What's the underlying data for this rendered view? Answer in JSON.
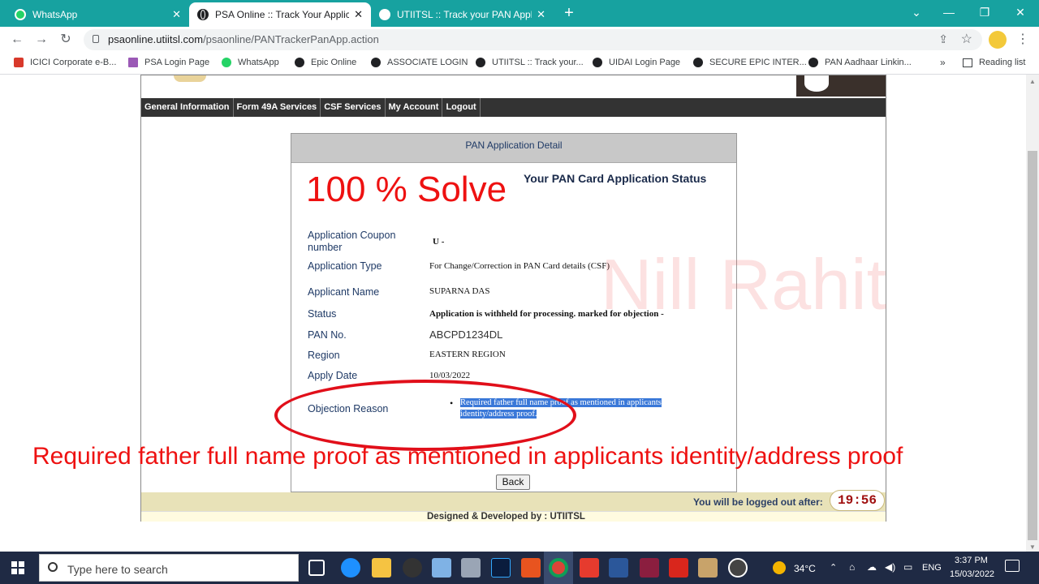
{
  "browser": {
    "tabs": [
      {
        "title": "WhatsApp",
        "icon": "whatsapp-icon",
        "active": false
      },
      {
        "title": "PSA Online :: Track Your Applicati",
        "icon": "globe-icon",
        "active": true
      },
      {
        "title": "UTIITSL :: Track your PAN Applica",
        "icon": "globe-icon",
        "active": false
      }
    ],
    "url_host": "psaonline.utiitsl.com",
    "url_path": "/psaonline/PANTrackerPanApp.action",
    "bookmarks": [
      {
        "label": "ICICI Corporate e-B...",
        "icon": "icici-icon"
      },
      {
        "label": "PSA Login Page",
        "icon": "psa-icon"
      },
      {
        "label": "WhatsApp",
        "icon": "whatsapp-icon"
      },
      {
        "label": "Epic Online",
        "icon": "globe-icon"
      },
      {
        "label": "ASSOCIATE LOGIN",
        "icon": "globe-icon"
      },
      {
        "label": "UTIITSL :: Track your...",
        "icon": "globe-icon"
      },
      {
        "label": "UIDAI Login Page",
        "icon": "globe-icon"
      },
      {
        "label": "SECURE EPIC INTER...",
        "icon": "globe-icon"
      },
      {
        "label": "PAN Aadhaar Linkin...",
        "icon": "globe-icon"
      }
    ],
    "more_bookmarks": "»",
    "reading_list": "Reading list"
  },
  "site": {
    "nav": [
      "General Information",
      "Form 49A Services",
      "CSF Services",
      "My Account",
      "Logout"
    ],
    "panel_title": "PAN Application Detail",
    "status_heading": "Your PAN Card Application Status",
    "fields": [
      {
        "label": "Application Coupon number",
        "value": "U -"
      },
      {
        "label": "Application Type",
        "value": "For Change/Correction in PAN Card details (CSF)"
      },
      {
        "label": "Applicant Name",
        "value": "SUPARNA DAS"
      },
      {
        "label": "Status",
        "value": "Application is withheld for processing. marked for objection -"
      },
      {
        "label": "PAN No.",
        "value": "ABCPD1234DL"
      },
      {
        "label": "Region",
        "value": "EASTERN REGION"
      },
      {
        "label": "Apply Date",
        "value": "10/03/2022"
      }
    ],
    "objection_label": "Objection Reason",
    "objection_reason": "Required father full name proof as mentioned in applicants identity/address proof.",
    "back_button": "Back",
    "logout_notice": "You will be logged out after:",
    "timer": "19:56",
    "footer": "Designed & Developed by : UTIITSL"
  },
  "overlay": {
    "headline": "100 % Solve",
    "caption": "Required father full name proof as mentioned in applicants identity/address proof",
    "watermark": "Nill Rahit"
  },
  "taskbar": {
    "search_placeholder": "Type here to search",
    "weather": "34°C",
    "language": "ENG",
    "time": "3:37 PM",
    "date": "15/03/2022"
  },
  "colors": {
    "tab_bar": "#17a2a0",
    "overlay_red": "#ee1111",
    "highlight": "#3a78d8"
  }
}
